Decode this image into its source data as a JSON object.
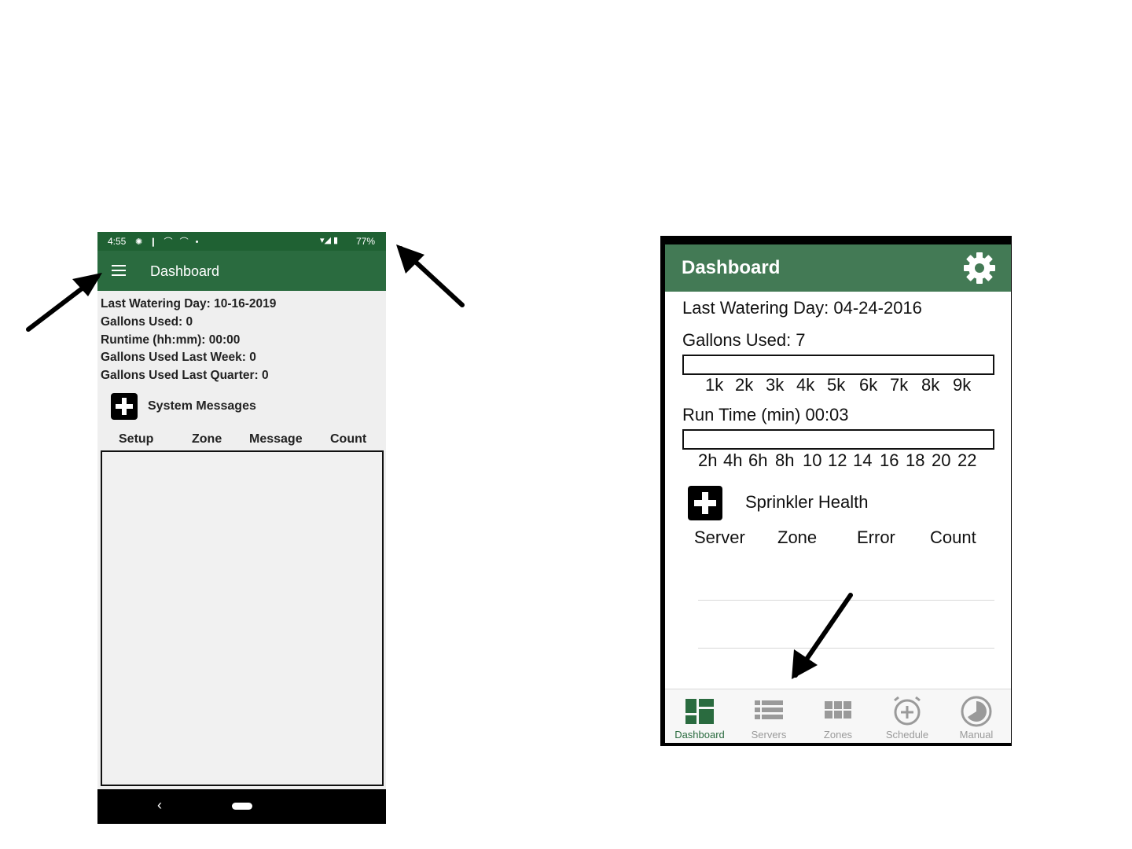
{
  "android": {
    "status_bar": {
      "time": "4:55",
      "battery": "77%"
    },
    "app_bar": {
      "title": "Dashboard"
    },
    "info": {
      "last_watering": "Last Watering Day: 10-16-2019",
      "gallons_used": "Gallons Used: 0",
      "runtime": "Runtime (hh:mm): 00:00",
      "gallons_last_week": "Gallons Used Last Week: 0",
      "gallons_last_quarter": "Gallons Used Last Quarter: 0"
    },
    "system_messages": {
      "label": "System Messages"
    },
    "table": {
      "columns": [
        "Setup",
        "Zone",
        "Message",
        "Count"
      ],
      "rows": []
    },
    "nav": {
      "back": "‹"
    }
  },
  "ios": {
    "header": {
      "title": "Dashboard",
      "settings_icon": "gear-icon"
    },
    "last_watering": "Last Watering Day: 04-24-2016",
    "gallons": {
      "label": "Gallons Used: 7",
      "ticks": [
        "1k",
        "2k",
        "3k",
        "4k",
        "5k",
        "6k",
        "7k",
        "8k",
        "9k"
      ]
    },
    "runtime": {
      "label": "Run Time (min) 00:03",
      "ticks": [
        "2h",
        "4h",
        "6h",
        "8h",
        "10",
        "12",
        "14",
        "16",
        "18",
        "20",
        "22"
      ]
    },
    "health": {
      "label": "Sprinkler Health",
      "columns": [
        "Server",
        "Zone",
        "Error",
        "Count"
      ]
    },
    "tabs": [
      {
        "label": "Dashboard",
        "icon": "dashboard-icon",
        "active": true
      },
      {
        "label": "Servers",
        "icon": "servers-icon",
        "active": false
      },
      {
        "label": "Zones",
        "icon": "zones-icon",
        "active": false
      },
      {
        "label": "Schedule",
        "icon": "schedule-icon",
        "active": false
      },
      {
        "label": "Manual",
        "icon": "manual-icon",
        "active": false
      }
    ]
  },
  "colors": {
    "android_green": "#2a6b3f",
    "status_green": "#1f6133",
    "ios_green": "#437a55"
  }
}
